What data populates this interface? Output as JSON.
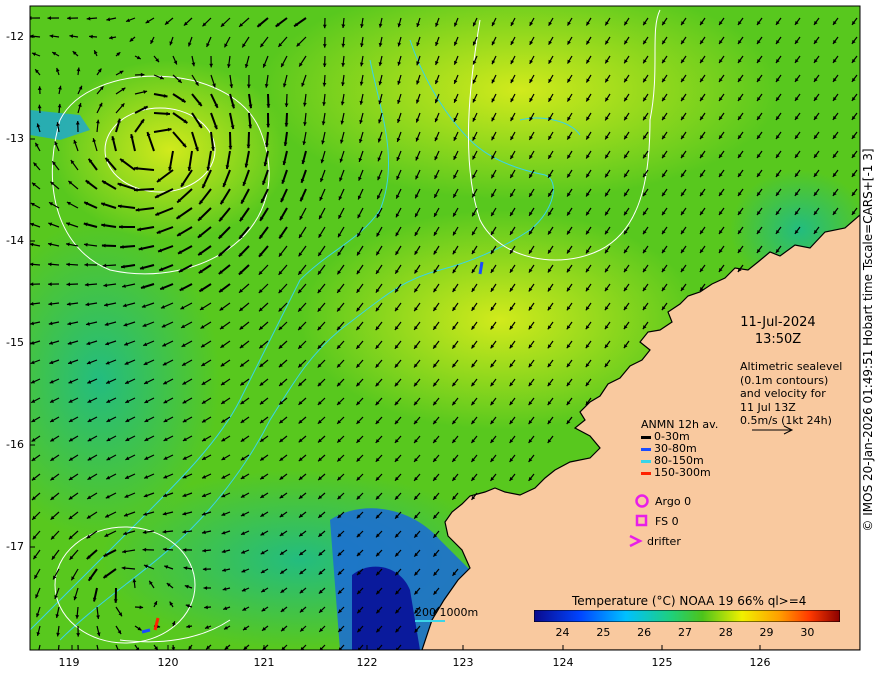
{
  "map": {
    "lon_range": [
      118.6,
      126.9
    ],
    "lat_range": [
      -17.98,
      -11.7
    ],
    "x_ticks": [
      "119",
      "120",
      "121",
      "122",
      "123",
      "124",
      "125",
      "126"
    ],
    "y_ticks": [
      "-12",
      "-13",
      "-14",
      "-15",
      "-16",
      "-17"
    ],
    "colors": {
      "land": "#f9c99f",
      "coastline": "#000000",
      "depth_contour": "#3ad4e8",
      "sealevel_contour": "#ffffff",
      "vector": "#000000"
    },
    "eddies": [
      {
        "name": "anticyclonic eddy",
        "lon": 119.85,
        "lat": -13.1
      },
      {
        "name": "south-west eddy",
        "lon": 119.2,
        "lat": -17.4
      }
    ]
  },
  "timestamp": {
    "date": "11-Jul-2024",
    "time": "13:50Z"
  },
  "altimetry_note": {
    "lines": [
      "Altimetric sealevel",
      "(0.1m contours)",
      "and velocity for",
      "11 Jul 13Z",
      "0.5m/s (1kt 24h)"
    ]
  },
  "anmn_legend": {
    "title": "ANMN 12h av.",
    "items": [
      {
        "label": "0-30m",
        "color": "#000000"
      },
      {
        "label": "30-80m",
        "color": "#1a4cff"
      },
      {
        "label": "80-150m",
        "color": "#3ad4e8"
      },
      {
        "label": "150-300m",
        "color": "#ff2200"
      }
    ]
  },
  "markers": {
    "argo": "Argo 0",
    "fs": "FS 0",
    "drifter": "drifter",
    "color": "#e81ee8"
  },
  "depth_contours": {
    "label": "200  1000m"
  },
  "colorbar": {
    "title": "Temperature (°C) NOAA 19 66% ql>=4",
    "min": 23.3,
    "max": 30.8,
    "ticks": [
      "24",
      "25",
      "26",
      "27",
      "28",
      "29",
      "30"
    ]
  },
  "credit": "© IMOS 20-Jan-2026 01:49:51 Hobart time Tscale=CARS+[-1 3]"
}
